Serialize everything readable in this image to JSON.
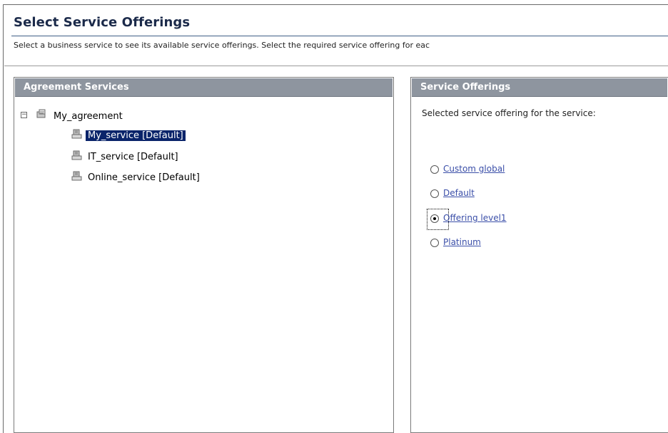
{
  "page": {
    "title": "Select Service Offerings",
    "instructions": "Select a business service to see its available service offerings. Select the required service offering for eac"
  },
  "left_panel": {
    "header": "Agreement Services",
    "root": {
      "label": "My_agreement",
      "expander": "−"
    },
    "children": [
      {
        "label": "My_service [Default]",
        "selected": true
      },
      {
        "label": "IT_service [Default]",
        "selected": false
      },
      {
        "label": "Online_service [Default]",
        "selected": false
      }
    ]
  },
  "right_panel": {
    "header": "Service Offerings",
    "caption": "Selected service offering for the service:",
    "options": [
      {
        "label": "Custom global",
        "checked": false
      },
      {
        "label": "Default",
        "checked": false
      },
      {
        "label": "Offering level1",
        "checked": true
      },
      {
        "label": "Platinum",
        "checked": false
      }
    ]
  },
  "colors": {
    "panel_header": "#8e959f",
    "title_text": "#1b2a4a",
    "selection": "#0a246a",
    "link": "#3a4ea8"
  },
  "icons": {
    "root": "agreement-icon",
    "service": "service-icon",
    "expander": "collapse-icon"
  }
}
